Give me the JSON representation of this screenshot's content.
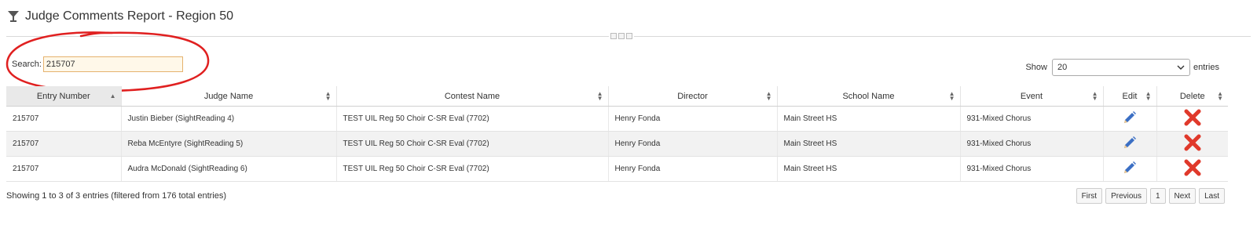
{
  "header": {
    "title": "Judge Comments Report - Region 50",
    "icon": "trophy-icon"
  },
  "search": {
    "label": "Search:",
    "value": "215707"
  },
  "length": {
    "show_label": "Show",
    "selected": "20",
    "entries_label": "entries"
  },
  "table": {
    "columns": [
      "Entry Number",
      "Judge Name",
      "Contest Name",
      "Director",
      "School Name",
      "Event",
      "Edit",
      "Delete"
    ],
    "sorted_column": "Entry Number",
    "rows": [
      {
        "entry": "215707",
        "judge": "Justin Bieber (SightReading 4)",
        "contest": "TEST UIL Reg 50 Choir C-SR Eval (7702)",
        "director": "Henry Fonda",
        "school": "Main Street HS",
        "event": "931-Mixed Chorus"
      },
      {
        "entry": "215707",
        "judge": "Reba McEntyre (SightReading 5)",
        "contest": "TEST UIL Reg 50 Choir C-SR Eval (7702)",
        "director": "Henry Fonda",
        "school": "Main Street HS",
        "event": "931-Mixed Chorus"
      },
      {
        "entry": "215707",
        "judge": "Audra McDonald (SightReading 6)",
        "contest": "TEST UIL Reg 50 Choir C-SR Eval (7702)",
        "director": "Henry Fonda",
        "school": "Main Street HS",
        "event": "931-Mixed Chorus"
      }
    ]
  },
  "footer": {
    "info": "Showing 1 to 3 of 3 entries (filtered from 176 total entries)",
    "pagination": [
      "First",
      "Previous",
      "1",
      "Next",
      "Last"
    ]
  },
  "colors": {
    "annotation_circle": "#e02020",
    "delete_icon": "#e0392b",
    "edit_icon": "#3b6fc4",
    "search_highlight": "#fff8e9"
  }
}
